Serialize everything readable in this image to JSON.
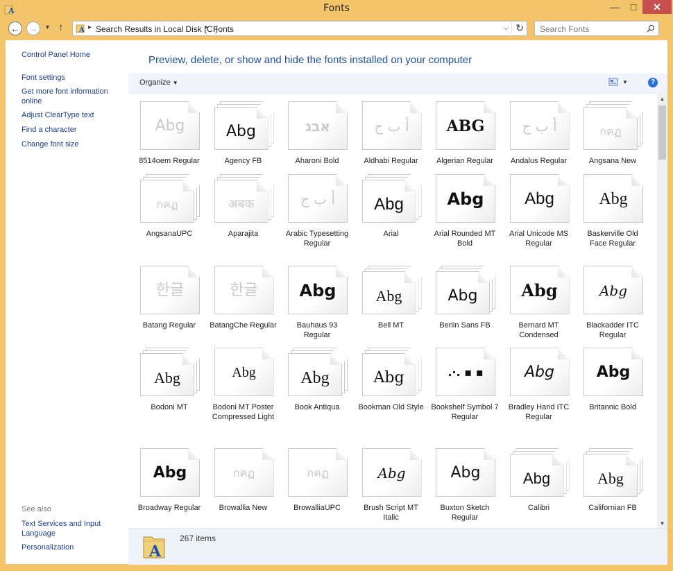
{
  "window": {
    "title": "Fonts",
    "controls": {
      "minimize": "—",
      "maximize": "□",
      "close": "✕"
    },
    "frame_color": "#f4c46a"
  },
  "address": {
    "crumbs": [
      "Search Results in Local Disk (C:)",
      "Fonts"
    ],
    "search_placeholder": "Search Fonts"
  },
  "sidebar": {
    "links": [
      "Control Panel Home",
      "Font settings",
      "Get more font information online",
      "Adjust ClearType text",
      "Find a character",
      "Change font size"
    ],
    "see_also_label": "See also",
    "see_also_links": [
      "Text Services and Input Language",
      "Personalization"
    ]
  },
  "main": {
    "heading": "Preview, delete, or show and hide the fonts installed on your computer",
    "organize_label": "Organize",
    "help_label": "?"
  },
  "fonts": [
    {
      "name": "8514oem Regular",
      "sample": "Abg",
      "stacked": false,
      "faded": true,
      "family": "\"DejaVu Sans\", sans-serif",
      "weight": "normal",
      "style": "normal",
      "size": 22
    },
    {
      "name": "Agency FB",
      "sample": "Abg",
      "stacked": true,
      "faded": false,
      "family": "\"DejaVu Sans\", sans-serif",
      "weight": "normal",
      "style": "normal",
      "size": 22
    },
    {
      "name": "Aharoni Bold",
      "sample": "אבג",
      "stacked": false,
      "faded": true,
      "family": "\"DejaVu Sans\", sans-serif",
      "weight": "bold",
      "style": "normal",
      "size": 20
    },
    {
      "name": "Aldhabi Regular",
      "sample": "أ ب ج",
      "stacked": false,
      "faded": true,
      "family": "\"DejaVu Serif\", serif",
      "weight": "normal",
      "style": "normal",
      "size": 20
    },
    {
      "name": "Algerian Regular",
      "sample": "ABG",
      "stacked": false,
      "faded": false,
      "family": "\"DejaVu Serif\", serif",
      "weight": "bold",
      "style": "normal",
      "size": 22
    },
    {
      "name": "Andalus Regular",
      "sample": "أ ب ج",
      "stacked": false,
      "faded": true,
      "family": "\"DejaVu Serif\", serif",
      "weight": "normal",
      "style": "normal",
      "size": 20
    },
    {
      "name": "Angsana New",
      "sample": "กคฏ",
      "stacked": true,
      "faded": true,
      "family": "\"DejaVu Sans\", sans-serif",
      "weight": "normal",
      "style": "normal",
      "size": 16
    },
    {
      "name": "AngsanaUPC",
      "sample": "กคฏ",
      "stacked": true,
      "faded": true,
      "family": "\"DejaVu Sans\", sans-serif",
      "weight": "normal",
      "style": "normal",
      "size": 16
    },
    {
      "name": "Aparajita",
      "sample": "अबक",
      "stacked": true,
      "faded": true,
      "family": "\"DejaVu Sans\", sans-serif",
      "weight": "normal",
      "style": "normal",
      "size": 18
    },
    {
      "name": "Arabic Typesetting Regular",
      "sample": "أ ب ج",
      "stacked": false,
      "faded": true,
      "family": "\"DejaVu Serif\", serif",
      "weight": "normal",
      "style": "normal",
      "size": 20
    },
    {
      "name": "Arial",
      "sample": "Abg",
      "stacked": true,
      "faded": false,
      "family": "\"Liberation Sans\", sans-serif",
      "weight": "normal",
      "style": "normal",
      "size": 24
    },
    {
      "name": "Arial Rounded MT Bold",
      "sample": "Abg",
      "stacked": false,
      "faded": false,
      "family": "\"DejaVu Sans\", sans-serif",
      "weight": "bold",
      "style": "normal",
      "size": 24
    },
    {
      "name": "Arial Unicode MS Regular",
      "sample": "Abg",
      "stacked": false,
      "faded": false,
      "family": "\"Liberation Sans\", sans-serif",
      "weight": "normal",
      "style": "normal",
      "size": 24
    },
    {
      "name": "Baskerville Old Face Regular",
      "sample": "Abg",
      "stacked": false,
      "faded": false,
      "family": "\"Liberation Serif\", serif",
      "weight": "normal",
      "style": "normal",
      "size": 24
    },
    {
      "name": "Batang Regular",
      "sample": "한글",
      "stacked": false,
      "faded": true,
      "family": "\"DejaVu Sans\", sans-serif",
      "weight": "normal",
      "style": "normal",
      "size": 22
    },
    {
      "name": "BatangChe Regular",
      "sample": "한글",
      "stacked": false,
      "faded": true,
      "family": "\"DejaVu Sans\", sans-serif",
      "weight": "normal",
      "style": "normal",
      "size": 22
    },
    {
      "name": "Bauhaus 93 Regular",
      "sample": "Abg",
      "stacked": false,
      "faded": false,
      "family": "\"DejaVu Sans\", sans-serif",
      "weight": "bold",
      "style": "normal",
      "size": 24
    },
    {
      "name": "Bell MT",
      "sample": "Abg",
      "stacked": true,
      "faded": false,
      "family": "\"Liberation Serif\", serif",
      "weight": "normal",
      "style": "normal",
      "size": 22
    },
    {
      "name": "Berlin Sans FB",
      "sample": "Abg",
      "stacked": true,
      "faded": false,
      "family": "\"DejaVu Sans\", sans-serif",
      "weight": "normal",
      "style": "normal",
      "size": 22
    },
    {
      "name": "Bernard MT Condensed",
      "sample": "Abg",
      "stacked": false,
      "faded": false,
      "family": "\"DejaVu Serif\", serif",
      "weight": "bold",
      "style": "normal",
      "size": 24
    },
    {
      "name": "Blackadder ITC Regular",
      "sample": "Abg",
      "stacked": false,
      "faded": false,
      "family": "\"DejaVu Serif\", serif",
      "weight": "normal",
      "style": "italic",
      "size": 20
    },
    {
      "name": "Bodoni MT",
      "sample": "Abg",
      "stacked": true,
      "faded": false,
      "family": "\"Liberation Serif\", serif",
      "weight": "normal",
      "style": "normal",
      "size": 22
    },
    {
      "name": "Bodoni MT Poster Compressed Light",
      "sample": "Abg",
      "stacked": false,
      "faded": false,
      "family": "\"Liberation Serif\", serif",
      "weight": "normal",
      "style": "normal",
      "size": 20
    },
    {
      "name": "Book Antiqua",
      "sample": "Abg",
      "stacked": true,
      "faded": false,
      "family": "\"Liberation Serif\", serif",
      "weight": "normal",
      "style": "normal",
      "size": 24
    },
    {
      "name": "Bookman Old Style",
      "sample": "Abg",
      "stacked": true,
      "faded": false,
      "family": "\"DejaVu Serif\", serif",
      "weight": "normal",
      "style": "normal",
      "size": 22
    },
    {
      "name": "Bookshelf Symbol 7 Regular",
      "sample": ".·. ▪ ▪",
      "stacked": false,
      "faded": false,
      "family": "\"DejaVu Sans\", sans-serif",
      "weight": "bold",
      "style": "normal",
      "size": 16
    },
    {
      "name": "Bradley Hand ITC Regular",
      "sample": "Abg",
      "stacked": false,
      "faded": false,
      "family": "\"DejaVu Sans\", sans-serif",
      "weight": "normal",
      "style": "italic",
      "size": 22
    },
    {
      "name": "Britannic Bold",
      "sample": "Abg",
      "stacked": false,
      "faded": false,
      "family": "\"DejaVu Sans\", sans-serif",
      "weight": "bold",
      "style": "normal",
      "size": 22
    },
    {
      "name": "Broadway Regular",
      "sample": "Abg",
      "stacked": false,
      "faded": false,
      "family": "\"DejaVu Sans\", sans-serif",
      "weight": "bold",
      "style": "normal",
      "size": 22
    },
    {
      "name": "Browallia New",
      "sample": "กคฏ",
      "stacked": false,
      "faded": true,
      "family": "\"DejaVu Sans\", sans-serif",
      "weight": "normal",
      "style": "normal",
      "size": 16
    },
    {
      "name": "BrowalliaUPC",
      "sample": "กคฏ",
      "stacked": false,
      "faded": true,
      "family": "\"DejaVu Sans\", sans-serif",
      "weight": "normal",
      "style": "normal",
      "size": 16
    },
    {
      "name": "Brush Script MT Italic",
      "sample": "Abg",
      "stacked": false,
      "faded": false,
      "family": "\"DejaVu Serif\", serif",
      "weight": "normal",
      "style": "italic",
      "size": 20
    },
    {
      "name": "Buxton Sketch Regular",
      "sample": "Abg",
      "stacked": false,
      "faded": false,
      "family": "\"DejaVu Sans\", sans-serif",
      "weight": "normal",
      "style": "normal",
      "size": 22
    },
    {
      "name": "Calibri",
      "sample": "Abg",
      "stacked": true,
      "faded": false,
      "family": "\"Liberation Sans\", sans-serif",
      "weight": "normal",
      "style": "normal",
      "size": 22
    },
    {
      "name": "Californian FB",
      "sample": "Abg",
      "stacked": true,
      "faded": false,
      "family": "\"Liberation Serif\", serif",
      "weight": "normal",
      "style": "normal",
      "size": 22
    }
  ],
  "details": {
    "count": "267 items"
  },
  "colors": {
    "link": "#1a3e8e",
    "heading": "#1e50a2",
    "close": "#c7504f",
    "faded_sample": "#c9c9c9",
    "sample": "#111111"
  }
}
